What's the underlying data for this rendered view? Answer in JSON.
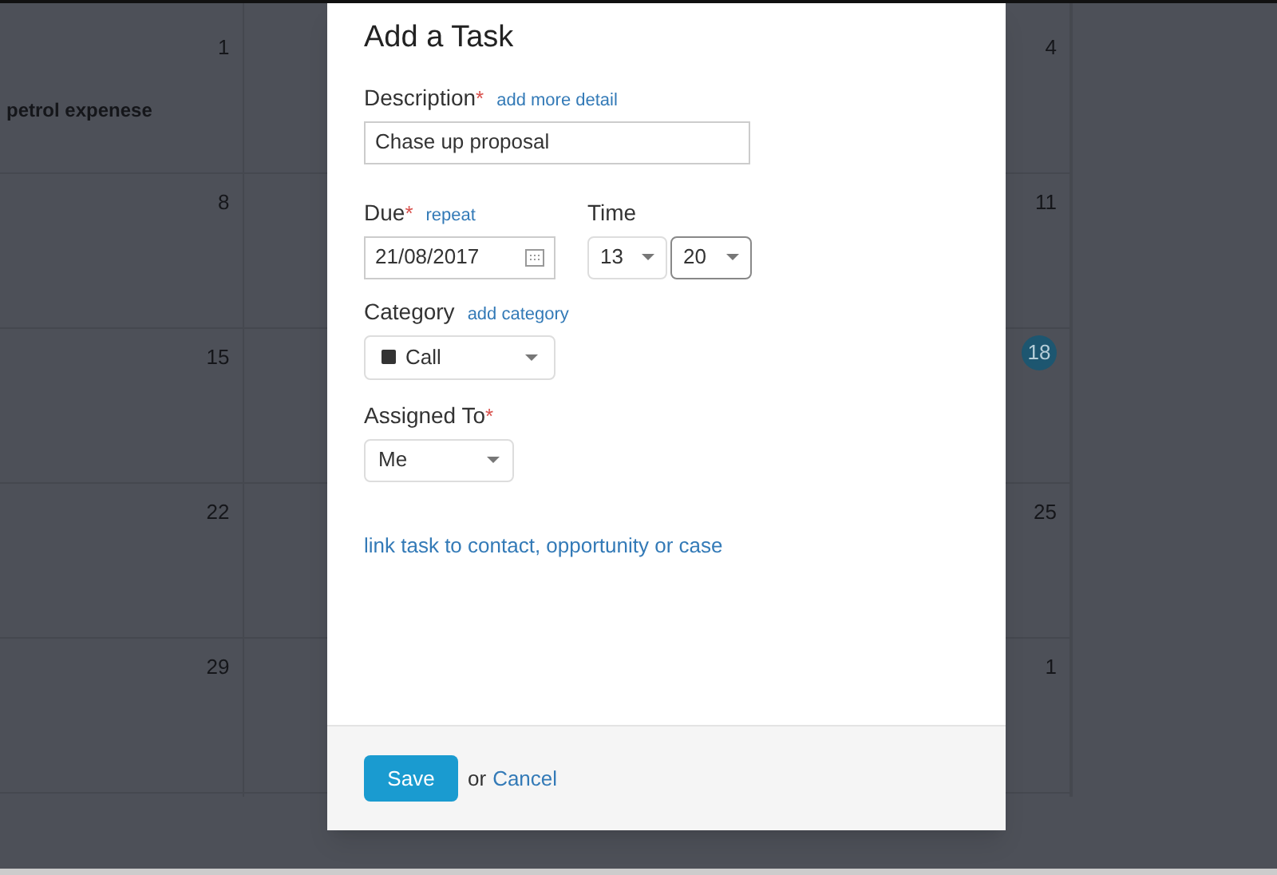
{
  "calendar": {
    "columns": [
      {
        "days": [
          {
            "number": "1",
            "today": false,
            "events": [
              "petrol expenese"
            ]
          },
          {
            "number": "8",
            "today": false
          },
          {
            "number": "15",
            "today": false
          },
          {
            "number": "22",
            "today": false
          },
          {
            "number": "29",
            "today": false
          }
        ]
      },
      {
        "days": [
          {
            "number": "4",
            "today": false
          },
          {
            "number": "11",
            "today": false
          },
          {
            "number": "18",
            "today": true
          },
          {
            "number": "25",
            "today": false
          },
          {
            "number": "1",
            "today": false
          }
        ]
      }
    ]
  },
  "dialog": {
    "title": "Add a Task",
    "description": {
      "label": "Description",
      "required_mark": "*",
      "link": "add more detail",
      "value": "Chase up proposal"
    },
    "due": {
      "label": "Due",
      "required_mark": "*",
      "link": "repeat",
      "value": "21/08/2017"
    },
    "time": {
      "label": "Time",
      "hour": "13",
      "minute": "20"
    },
    "category": {
      "label": "Category",
      "link": "add category",
      "value": "Call",
      "color": "#333333"
    },
    "assigned": {
      "label": "Assigned To",
      "required_mark": "*",
      "value": "Me"
    },
    "link": "link task to contact, opportunity or case",
    "footer": {
      "save": "Save",
      "or": "or",
      "cancel": "Cancel"
    }
  }
}
